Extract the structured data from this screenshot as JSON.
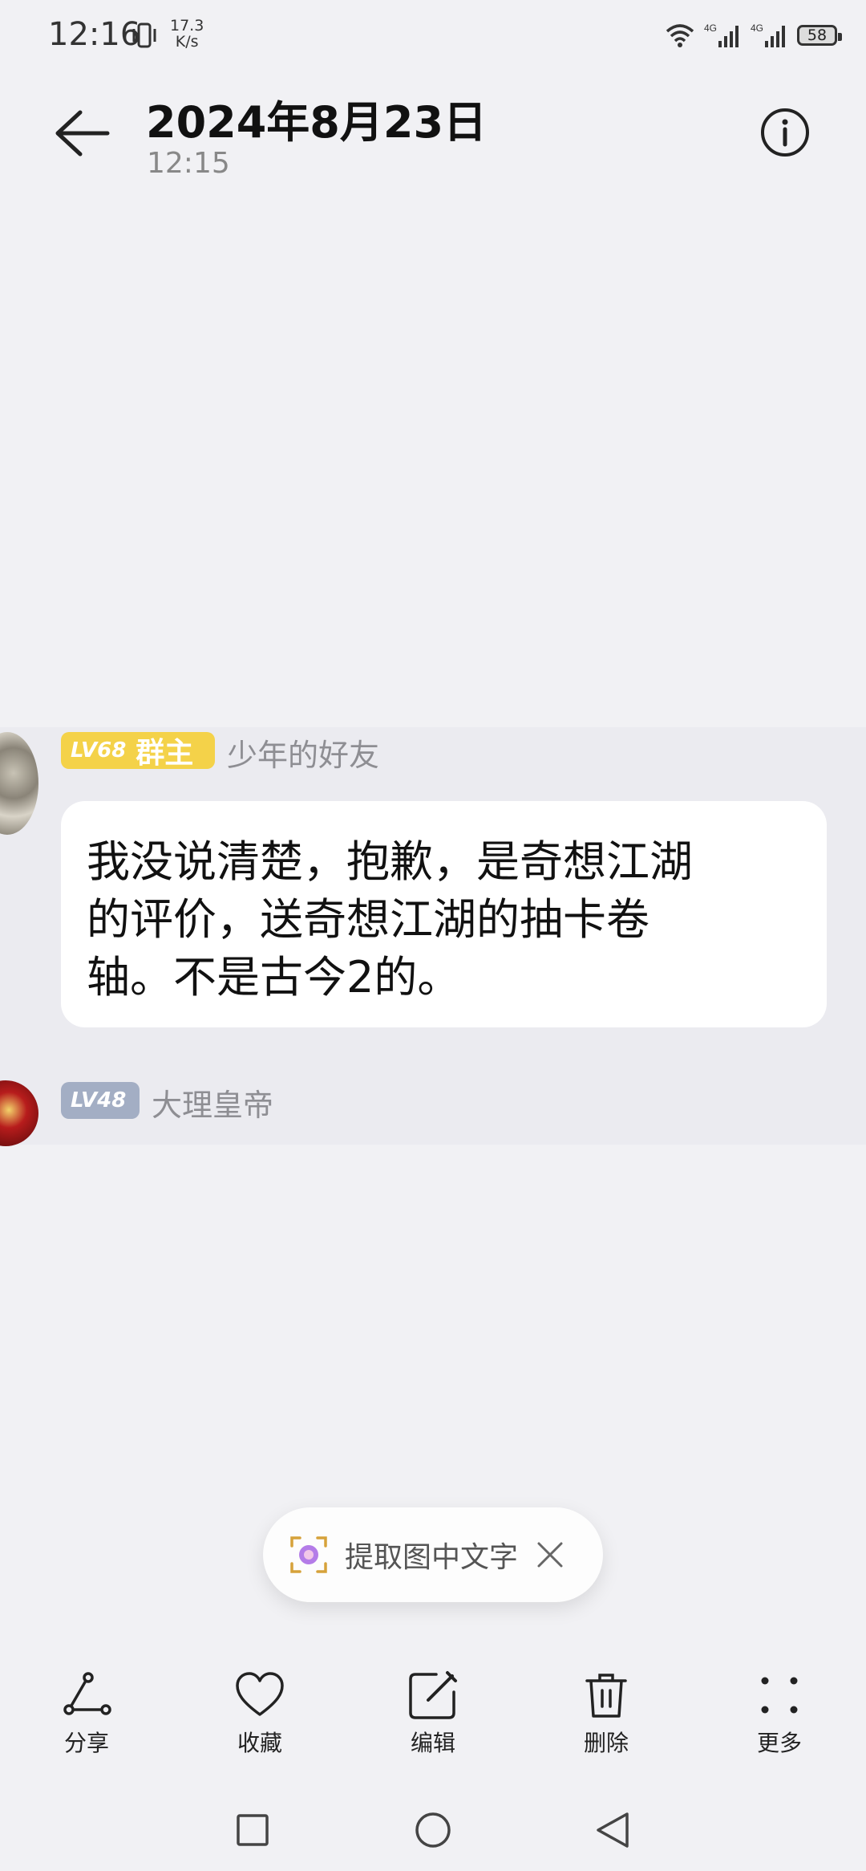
{
  "status_bar": {
    "time": "12:16",
    "speed_value": "17.3",
    "speed_unit": "K/s",
    "battery": "58",
    "icons": [
      "vibrate-icon",
      "wifi-icon",
      "signal-4g-icon",
      "signal-4g-icon",
      "battery-icon"
    ]
  },
  "header": {
    "title": "2024年8月23日",
    "subtitle": "12:15",
    "back_icon": "back-arrow-icon",
    "info_icon": "info-icon"
  },
  "image": {
    "messages": [
      {
        "level": "LV68",
        "role": "群主",
        "username": "少年的好友",
        "badge_color": "#f4d249",
        "text_lines": [
          "我没说清楚，抱歉，是奇想江湖",
          "的评价，送奇想江湖的抽卡卷",
          "轴。不是古今2的。"
        ]
      },
      {
        "level": "LV48",
        "username": "大理皇帝",
        "badge_color": "#a3aec4"
      }
    ]
  },
  "ocr_pill": {
    "label": "提取图中文字",
    "icon": "scan-text-icon",
    "close_icon": "close-icon"
  },
  "toolbar": {
    "items": [
      {
        "label": "分享",
        "icon": "share-icon"
      },
      {
        "label": "收藏",
        "icon": "heart-icon"
      },
      {
        "label": "编辑",
        "icon": "edit-icon"
      },
      {
        "label": "删除",
        "icon": "trash-icon"
      },
      {
        "label": "更多",
        "icon": "more-icon"
      }
    ]
  },
  "navbar": {
    "icons": [
      "recent-apps-icon",
      "home-icon",
      "back-icon"
    ]
  }
}
